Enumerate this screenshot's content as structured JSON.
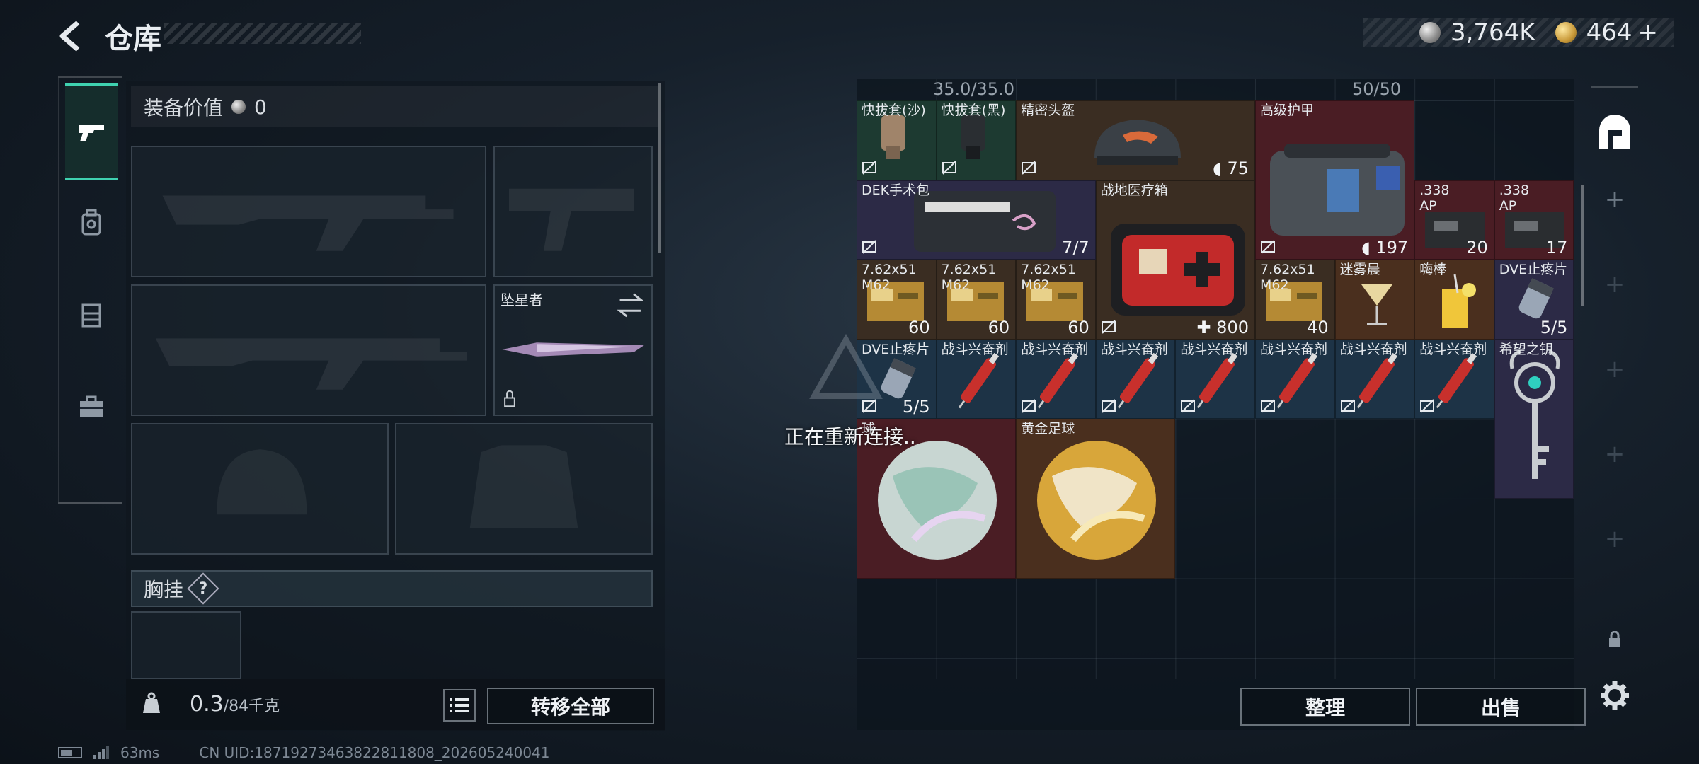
{
  "header": {
    "title": "仓库"
  },
  "currency": {
    "silver": "3,764K",
    "gold": "464"
  },
  "equipment": {
    "value_label": "装备价值",
    "value": "0",
    "melee_name": "坠星者",
    "chest_label": "胸挂",
    "chest_help": "?"
  },
  "weight": {
    "current": "0.3",
    "max": "/84千克"
  },
  "buttons": {
    "transfer_all": "转移全部",
    "sort": "整理",
    "sell": "出售"
  },
  "status": {
    "ping": "63ms",
    "uid": "CN UID:18719273463822811808_202605240041"
  },
  "reconnect": "正在重新连接..",
  "storage": {
    "top_left": "35.0/35.0",
    "top_right": "50/50",
    "items": [
      {
        "name": "快拔套(沙)",
        "count": ""
      },
      {
        "name": "快拔套(黑)",
        "count": ""
      },
      {
        "name": "精密头盔",
        "count": "75"
      },
      {
        "name": "高级护甲",
        "count": "197"
      },
      {
        "name": "DEK手术包",
        "count": "7/7"
      },
      {
        "name": "战地医疗箱",
        "count": "800"
      },
      {
        "name": ".338\nAP",
        "count": "20"
      },
      {
        "name": ".338\nAP",
        "count": "17"
      },
      {
        "name": "7.62x51\nM62",
        "count": "60"
      },
      {
        "name": "7.62x51\nM62",
        "count": "60"
      },
      {
        "name": "7.62x51\nM62",
        "count": "60"
      },
      {
        "name": "7.62x51\nM62",
        "count": "40"
      },
      {
        "name": "迷雾晨",
        "count": ""
      },
      {
        "name": "嗨棒",
        "count": ""
      },
      {
        "name": "DVE止疼片",
        "count": "5/5"
      },
      {
        "name": "DVE止疼片",
        "count": "5/5"
      },
      {
        "name": "战斗兴奋剂",
        "count": ""
      },
      {
        "name": "战斗兴奋剂",
        "count": ""
      },
      {
        "name": "战斗兴奋剂",
        "count": ""
      },
      {
        "name": "战斗兴奋剂",
        "count": ""
      },
      {
        "name": "战斗兴奋剂",
        "count": ""
      },
      {
        "name": "战斗兴奋剂",
        "count": ""
      },
      {
        "name": "战斗兴奋剂",
        "count": ""
      },
      {
        "name": "希望之钥",
        "count": ""
      },
      {
        "name": "球",
        "count": ""
      },
      {
        "name": "黄金足球",
        "count": ""
      }
    ]
  },
  "colors": {
    "accent": "#3fd2b0",
    "rarity_red": "#4a1d24",
    "rarity_gold": "#4a2f1e",
    "rarity_purple": "#2c2a46",
    "rarity_blue": "#1d3346",
    "rarity_green": "#1d3a31"
  },
  "icons": [
    "back-icon",
    "silver-coin-icon",
    "gold-coin-icon",
    "gun-tab-icon",
    "backpack-tab-icon",
    "vest-tab-icon",
    "case-tab-icon",
    "weight-icon",
    "list-icon",
    "base-icon",
    "plus-icon",
    "lock-icon",
    "gear-icon",
    "swap-icon",
    "no-trade-icon",
    "armor-icon",
    "medical-cross-icon"
  ]
}
